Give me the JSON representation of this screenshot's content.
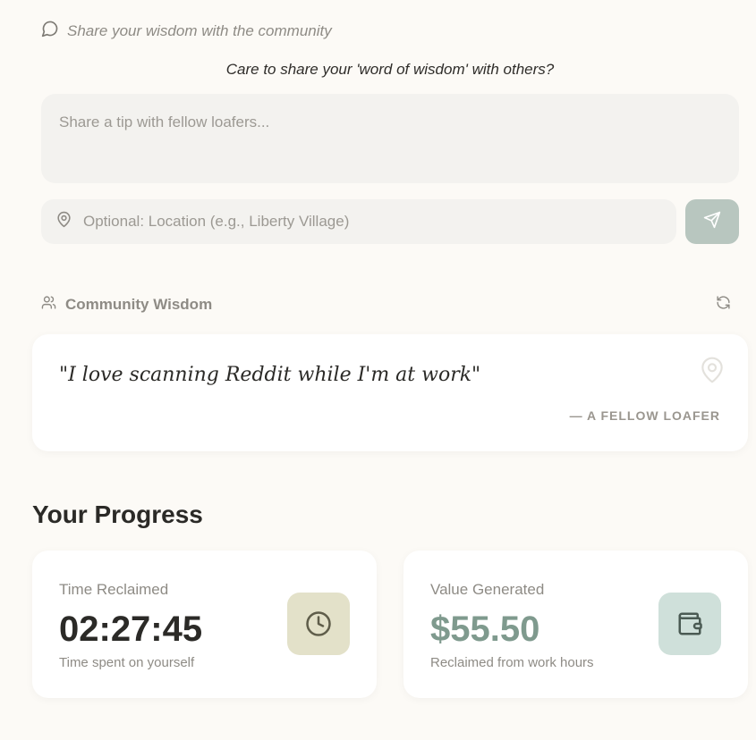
{
  "share": {
    "header": "Share your wisdom with the community",
    "prompt": "Care to share your 'word of wisdom' with others?",
    "tip_placeholder": "Share a tip with fellow loafers...",
    "location_placeholder": "Optional: Location (e.g., Liberty Village)"
  },
  "community": {
    "title": "Community Wisdom",
    "quote": "\"I love scanning Reddit while I'm at work\"",
    "author": "— A FELLOW LOAFER"
  },
  "progress": {
    "title": "Your Progress",
    "time": {
      "label": "Time Reclaimed",
      "value": "02:27:45",
      "sub": "Time spent on yourself",
      "icon": "clock-icon"
    },
    "money": {
      "label": "Value Generated",
      "value": "$55.50",
      "sub": "Reclaimed from work hours",
      "icon": "wallet-icon"
    }
  },
  "colors": {
    "background": "#fcfaf6",
    "accent_green": "#7f9a8e",
    "send_button": "#b8c6bf",
    "clock_tile": "#e3e1c9",
    "wallet_tile": "#cfe0da"
  }
}
